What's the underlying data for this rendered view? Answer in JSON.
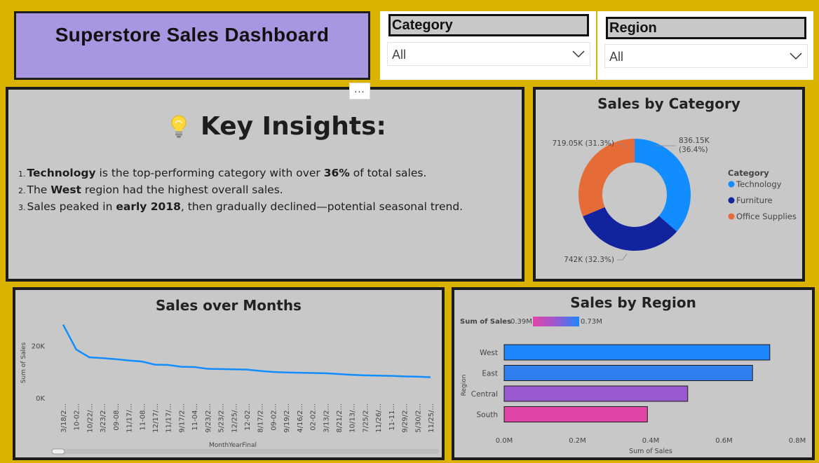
{
  "dashboard_title": "Superstore Sales Dashboard",
  "slicers": [
    {
      "label": "Category",
      "value": "All"
    },
    {
      "label": "Region",
      "value": "All"
    }
  ],
  "more_options": "...",
  "insights": {
    "title": "Key Insights:",
    "icon": "lightbulb-icon",
    "items": [
      {
        "num": "1.",
        "parts": [
          {
            "t": "Technology",
            "b": true
          },
          {
            "t": " is the top-performing category with over ",
            "b": false
          },
          {
            "t": "36%",
            "b": true
          },
          {
            "t": " of total sales.",
            "b": false
          }
        ]
      },
      {
        "num": "2.",
        "parts": [
          {
            "t": "The ",
            "b": false
          },
          {
            "t": "West",
            "b": true
          },
          {
            "t": " region had the highest overall sales.",
            "b": false
          }
        ]
      },
      {
        "num": "3.",
        "parts": [
          {
            "t": "Sales peaked in ",
            "b": false
          },
          {
            "t": "early 2018",
            "b": true
          },
          {
            "t": ", then gradually declined—potential seasonal trend.",
            "b": false
          }
        ]
      }
    ]
  },
  "category_chart": {
    "title": "Sales by Category",
    "legend_title": "Category",
    "chart_data": {
      "type": "pie",
      "donut": true,
      "title": "Sales by Category",
      "slices": [
        {
          "name": "Technology",
          "value": 836150,
          "label": "836.15K",
          "pct": "(36.4%)",
          "color": "#118dff"
        },
        {
          "name": "Furniture",
          "value": 742000,
          "label": "742K (32.3%)",
          "color": "#12239e"
        },
        {
          "name": "Office Supplies",
          "value": 719050,
          "label": "719.05K (31.3%)",
          "color": "#e66c37"
        }
      ],
      "legend_position": "right"
    }
  },
  "months_chart": {
    "title": "Sales over Months",
    "xlabel": "MonthYearFinal",
    "ylabel": "Sum of Sales",
    "chart_data": {
      "type": "line",
      "title": "Sales over Months",
      "xlabel": "MonthYearFinal",
      "ylabel": "Sum of Sales",
      "yticks": [
        "0K",
        "20K"
      ],
      "ylim": [
        0,
        30000
      ],
      "color": "#118dff",
      "x": [
        "3/18/2...",
        "10-02...",
        "10/22/...",
        "3/23/2...",
        "09-08...",
        "11/17/...",
        "11-08...",
        "12/17/...",
        "11/17/...",
        "9/17/2...",
        "11-04...",
        "9/23/2...",
        "5/23/2...",
        "12/25/...",
        "12-02...",
        "8/17/2...",
        "09-02...",
        "9/19/2...",
        "4/16/2...",
        "02-02...",
        "3/13/2...",
        "8/21/2...",
        "10/13/...",
        "7/25/2...",
        "11/26/...",
        "11-11...",
        "9/29/2...",
        "5/30/2...",
        "11/25/..."
      ],
      "values": [
        28000,
        18500,
        15500,
        15200,
        14800,
        14300,
        13900,
        12700,
        12600,
        11900,
        11800,
        11100,
        11000,
        10900,
        10800,
        10300,
        9900,
        9700,
        9600,
        9500,
        9400,
        9100,
        8800,
        8600,
        8500,
        8400,
        8200,
        8100,
        7900
      ]
    }
  },
  "region_chart": {
    "title": "Sales by Region",
    "xlabel": "Sum of Sales",
    "ylabel": "Region",
    "gradient_legend": {
      "label": "Sum of Sales",
      "min": "0.39M",
      "max": "0.73M"
    },
    "chart_data": {
      "type": "bar",
      "orientation": "horizontal",
      "title": "Sales by Region",
      "categories": [
        "West",
        "East",
        "Central",
        "South"
      ],
      "values": [
        725000,
        678000,
        501000,
        391000
      ],
      "colors": [
        "#1d86fb",
        "#2f7ff0",
        "#9b59d0",
        "#e245a8"
      ],
      "xticks": [
        "0.0M",
        "0.2M",
        "0.4M",
        "0.6M",
        "0.8M"
      ],
      "xlim": [
        0,
        800000
      ],
      "xlabel": "Sum of Sales",
      "ylabel": "Region"
    }
  }
}
